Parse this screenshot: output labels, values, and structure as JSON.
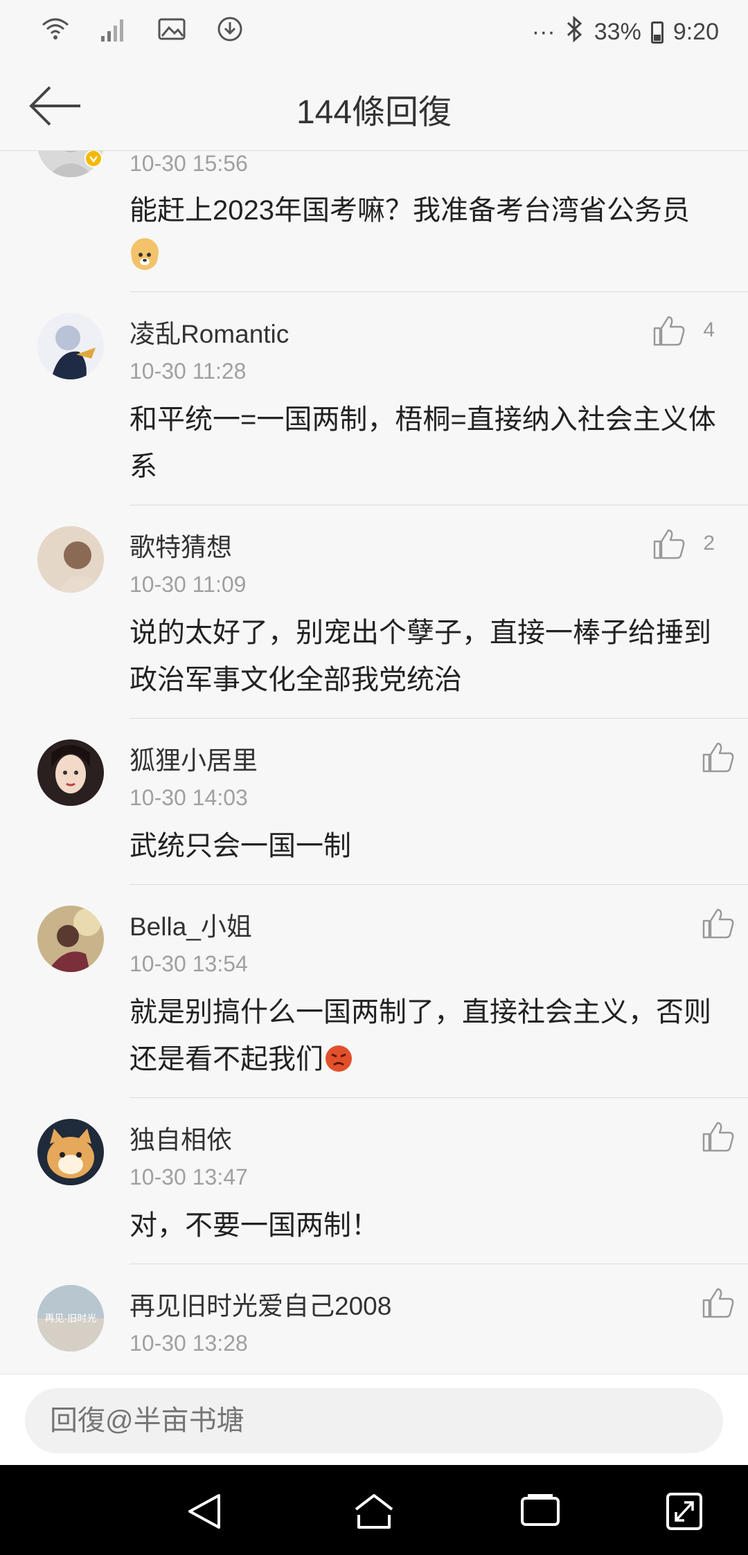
{
  "status": {
    "dots": "···",
    "battery": "33%",
    "time": "9:20"
  },
  "header": {
    "title": "144條回復"
  },
  "comments": [
    {
      "time": "10-30 15:56",
      "text": "能赶上2023年国考嘛？我准备考台湾省公务员",
      "emoji": "doge-emoji"
    },
    {
      "user": "凌乱Romantic",
      "time": "10-30 11:28",
      "text": "和平统一=一国两制，梧桐=直接纳入社会主义体系",
      "likes": "4"
    },
    {
      "user": "歌特猜想",
      "time": "10-30 11:09",
      "text": "说的太好了，别宠出个孽子，直接一棒子给捶到政治军事文化全部我党统治",
      "likes": "2"
    },
    {
      "user": "狐狸小居里",
      "time": "10-30 14:03",
      "text": "武统只会一国一制"
    },
    {
      "user": "Bella_小姐",
      "time": "10-30 13:54",
      "text": "就是别搞什么一国两制了，直接社会主义，否则还是看不起我们",
      "emoji": "angry-emoji"
    },
    {
      "user": "独自相依",
      "time": "10-30 13:47",
      "text": "对，不要一国两制！"
    },
    {
      "user": "再见旧时光爱自己2008",
      "time": "10-30 13:28",
      "avatar_text": "再见·旧时光"
    }
  ],
  "reply": {
    "placeholder": "回復@半亩书塘"
  },
  "colors": {
    "background": "#f7f7f7",
    "verified_badge": "#f5b800",
    "muted": "#a0a0a0"
  }
}
